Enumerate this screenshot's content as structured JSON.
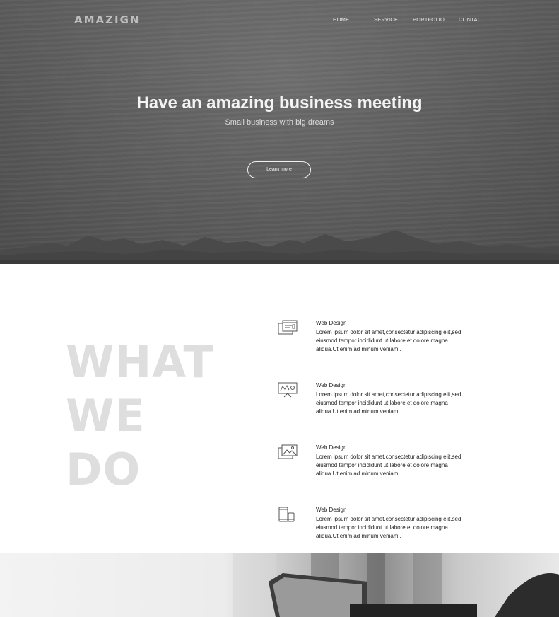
{
  "brand": {
    "logo_text": "AMAZIGN"
  },
  "nav": {
    "items": [
      {
        "label": "HOME"
      },
      {
        "label": "SERVICE"
      },
      {
        "label": "PORTFOLIO"
      },
      {
        "label": "CONTACT"
      }
    ]
  },
  "hero": {
    "title": "Have an amazing business meeting",
    "subtitle": "Small business with big dreams",
    "cta_label": "Learn more"
  },
  "services": {
    "heading_lines": [
      "WHAT",
      "WE",
      "DO"
    ],
    "items": [
      {
        "icon": "browser-windows-icon",
        "title": "Web Design",
        "description": "Lorem ipsum dolor sit amet,consectetur adipiscing elit,sed eiusmod tempor incididunt ut labore et dolore magna aliqua.Ut enim ad minum veniaml."
      },
      {
        "icon": "presentation-board-icon",
        "title": "Web Design",
        "description": "Lorem ipsum dolor sit amet,consectetur adipiscing elit,sed eiusmod tempor incididunt ut labore et dolore magna aliqua.Ut enim ad minum veniaml."
      },
      {
        "icon": "image-gallery-icon",
        "title": "Web Design",
        "description": "Lorem ipsum dolor sit amet,consectetur adipiscing elit,sed eiusmod tempor incididunt ut labore et dolore magna aliqua.Ut enim ad minum veniaml."
      },
      {
        "icon": "mobile-devices-icon",
        "title": "Web Design",
        "description": "Lorem ipsum dolor sit amet,consectetur adipiscing elit,sed eiusmod tempor incididunt ut labore et dolore magna aliqua.Ut enim ad minum veniaml."
      }
    ]
  },
  "colors": {
    "hero_bg": "#5c5c5c",
    "heading_watermark": "#dedede",
    "text_dark": "#222222"
  }
}
